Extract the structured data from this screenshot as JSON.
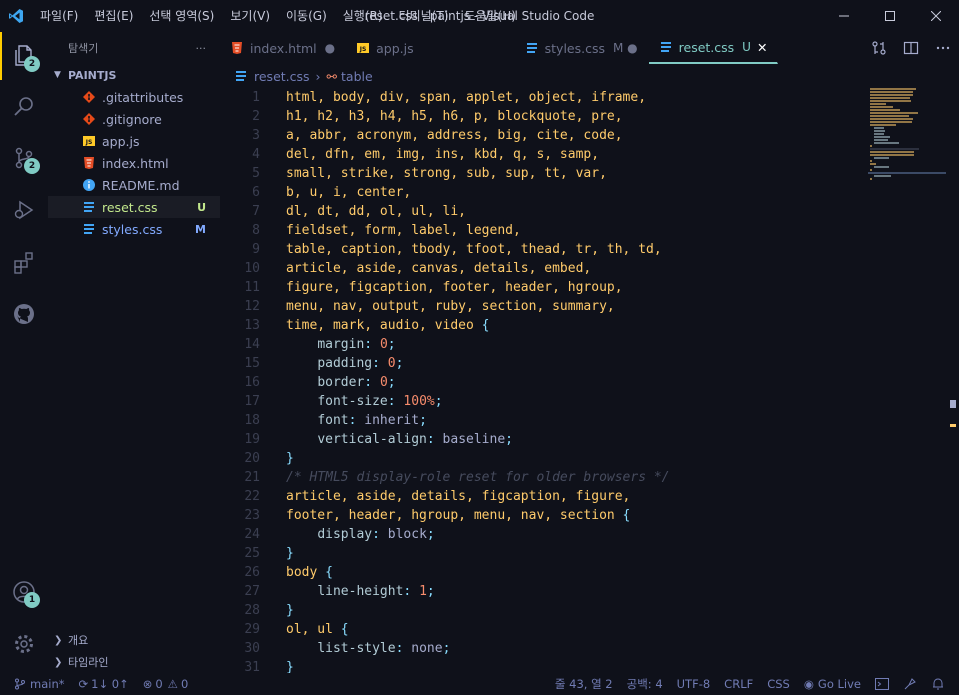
{
  "titlebar": {
    "window_title": "reset.css - paintjs - Visual Studio Code",
    "menu": [
      "파일(F)",
      "편집(E)",
      "선택 영역(S)",
      "보기(V)",
      "이동(G)",
      "실행(R)",
      "터미널(T)",
      "도움말(H)"
    ]
  },
  "activity_bar": {
    "explorer_badge": "2",
    "scm_badge": "2",
    "accounts_badge": "1"
  },
  "sidebar": {
    "title": "탐색기",
    "more": "···",
    "project": "PAINTJS",
    "files": [
      {
        "name": ".gitattributes",
        "icon": "git-icon",
        "status": "",
        "color": "#a6accd"
      },
      {
        "name": ".gitignore",
        "icon": "git-icon",
        "status": "",
        "color": "#a6accd"
      },
      {
        "name": "app.js",
        "icon": "js-icon",
        "status": "",
        "color": "#a6accd"
      },
      {
        "name": "index.html",
        "icon": "html-icon",
        "status": "",
        "color": "#a6accd"
      },
      {
        "name": "README.md",
        "icon": "info-icon",
        "status": "",
        "color": "#a6accd"
      },
      {
        "name": "reset.css",
        "icon": "css-icon",
        "status": "U",
        "color": "#c3e88d"
      },
      {
        "name": "styles.css",
        "icon": "css-icon",
        "status": "M",
        "color": "#82aaff"
      }
    ],
    "outline": "개요",
    "timeline": "타임라인"
  },
  "tabs": [
    {
      "label": "index.html",
      "icon": "html-icon",
      "mark": "●",
      "active": false
    },
    {
      "label": "app.js",
      "icon": "js-icon",
      "mark": "",
      "active": false
    },
    {
      "label": "styles.css",
      "icon": "css-icon",
      "mark": "M ●",
      "active": false
    },
    {
      "label": "reset.css",
      "icon": "css-icon",
      "mark": "U",
      "active": true
    }
  ],
  "breadcrumb": {
    "file": "reset.css",
    "symbol": "table"
  },
  "code_lines": [
    [
      [
        "sel",
        "html, body, div, span, applet, object, iframe,"
      ]
    ],
    [
      [
        "sel",
        "h1, h2, h3, h4, h5, h6, p, blockquote, pre,"
      ]
    ],
    [
      [
        "sel",
        "a, abbr, acronym, address, big, cite, code,"
      ]
    ],
    [
      [
        "sel",
        "del, dfn, em, img, ins, kbd, q, s, samp,"
      ]
    ],
    [
      [
        "sel",
        "small, strike, strong, sub, sup, tt, var,"
      ]
    ],
    [
      [
        "sel",
        "b, u, i, center,"
      ]
    ],
    [
      [
        "sel",
        "dl, dt, dd, ol, ul, li,"
      ]
    ],
    [
      [
        "sel",
        "fieldset, form, label, legend,"
      ]
    ],
    [
      [
        "sel",
        "table, caption, tbody, tfoot, thead, tr, th, td,"
      ]
    ],
    [
      [
        "sel",
        "article, aside, canvas, details, embed,"
      ]
    ],
    [
      [
        "sel",
        "figure, figcaption, footer, header, hgroup,"
      ]
    ],
    [
      [
        "sel",
        "menu, nav, output, ruby, section, summary,"
      ]
    ],
    [
      [
        "sel",
        "time, mark, audio, video "
      ],
      [
        "brace",
        "{"
      ]
    ],
    [
      [
        "val",
        "    "
      ],
      [
        "prop",
        "margin"
      ],
      [
        "punc",
        ": "
      ],
      [
        "num",
        "0"
      ],
      [
        "punc",
        ";"
      ]
    ],
    [
      [
        "val",
        "    "
      ],
      [
        "prop",
        "padding"
      ],
      [
        "punc",
        ": "
      ],
      [
        "num",
        "0"
      ],
      [
        "punc",
        ";"
      ]
    ],
    [
      [
        "val",
        "    "
      ],
      [
        "prop",
        "border"
      ],
      [
        "punc",
        ": "
      ],
      [
        "num",
        "0"
      ],
      [
        "punc",
        ";"
      ]
    ],
    [
      [
        "val",
        "    "
      ],
      [
        "prop",
        "font-size"
      ],
      [
        "punc",
        ": "
      ],
      [
        "num",
        "100%"
      ],
      [
        "punc",
        ";"
      ]
    ],
    [
      [
        "val",
        "    "
      ],
      [
        "prop",
        "font"
      ],
      [
        "punc",
        ": "
      ],
      [
        "val",
        "inherit"
      ],
      [
        "punc",
        ";"
      ]
    ],
    [
      [
        "val",
        "    "
      ],
      [
        "prop",
        "vertical-align"
      ],
      [
        "punc",
        ": "
      ],
      [
        "val",
        "baseline"
      ],
      [
        "punc",
        ";"
      ]
    ],
    [
      [
        "brace",
        "}"
      ]
    ],
    [
      [
        "comment",
        "/* HTML5 display-role reset for older browsers */"
      ]
    ],
    [
      [
        "sel",
        "article, aside, details, figcaption, figure,"
      ]
    ],
    [
      [
        "sel",
        "footer, header, hgroup, menu, nav, section "
      ],
      [
        "brace",
        "{"
      ]
    ],
    [
      [
        "val",
        "    "
      ],
      [
        "prop",
        "display"
      ],
      [
        "punc",
        ": "
      ],
      [
        "val",
        "block"
      ],
      [
        "punc",
        ";"
      ]
    ],
    [
      [
        "brace",
        "}"
      ]
    ],
    [
      [
        "sel",
        "body "
      ],
      [
        "brace",
        "{"
      ]
    ],
    [
      [
        "val",
        "    "
      ],
      [
        "prop",
        "line-height"
      ],
      [
        "punc",
        ": "
      ],
      [
        "num",
        "1"
      ],
      [
        "punc",
        ";"
      ]
    ],
    [
      [
        "brace",
        "}"
      ]
    ],
    [
      [
        "sel",
        "ol, ul "
      ],
      [
        "brace",
        "{"
      ]
    ],
    [
      [
        "val",
        "    "
      ],
      [
        "prop",
        "list-style"
      ],
      [
        "punc",
        ": "
      ],
      [
        "val",
        "none"
      ],
      [
        "punc",
        ";"
      ]
    ],
    [
      [
        "brace",
        "}"
      ]
    ]
  ],
  "statusbar": {
    "branch": "main*",
    "sync": "1↓ 0↑",
    "errors": "0",
    "warnings": "0",
    "position": "줄 43, 열 2",
    "spaces": "공백: 4",
    "encoding": "UTF-8",
    "eol": "CRLF",
    "language": "CSS",
    "golive": "Go Live"
  },
  "colors": {
    "accent": "#80cbc4",
    "selector": "#ffcb6b",
    "background": "#0f111a"
  }
}
